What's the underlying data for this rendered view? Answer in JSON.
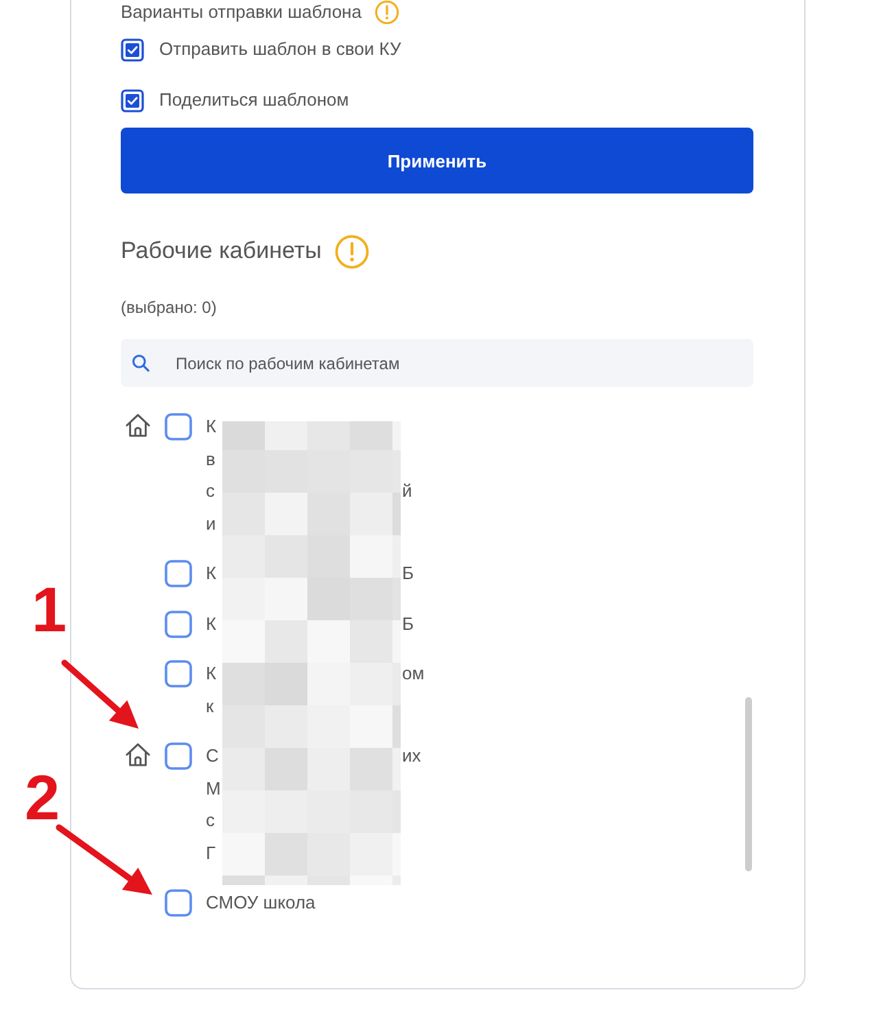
{
  "send_options": {
    "title": "Варианты отправки шаблона",
    "options": [
      {
        "label": "Отправить шаблон в свои КУ",
        "checked": true
      },
      {
        "label": "Поделиться шаблоном",
        "checked": true
      }
    ]
  },
  "apply_button": {
    "label": "Применить"
  },
  "workspaces": {
    "title": "Рабочие кабинеты",
    "selected_count": "(выбрано: 0)",
    "search": {
      "placeholder": "Поиск по рабочим кабинетам"
    },
    "redacted": true,
    "items": [
      {
        "home": true,
        "checked": false,
        "lines": [
          {
            "start": "К"
          },
          {
            "start": "в"
          },
          {
            "start": "с",
            "end": "й"
          },
          {
            "start": "и"
          }
        ]
      },
      {
        "home": false,
        "checked": false,
        "lines": [
          {
            "start": "К",
            "end": "Б"
          }
        ]
      },
      {
        "home": false,
        "checked": false,
        "lines": [
          {
            "start": "К",
            "end": "Б"
          }
        ]
      },
      {
        "home": false,
        "checked": false,
        "lines": [
          {
            "start": "К",
            "end": "ом"
          },
          {
            "start": "к"
          }
        ]
      },
      {
        "home": true,
        "checked": false,
        "lines": [
          {
            "start": "С",
            "end": "их"
          },
          {
            "start": "М"
          },
          {
            "start": "с"
          },
          {
            "start": "Г"
          }
        ]
      },
      {
        "home": false,
        "checked": false,
        "lines": [
          {
            "start": "СМОУ школа"
          }
        ]
      }
    ]
  },
  "annotations": [
    {
      "label": "1"
    },
    {
      "label": "2"
    }
  ]
}
